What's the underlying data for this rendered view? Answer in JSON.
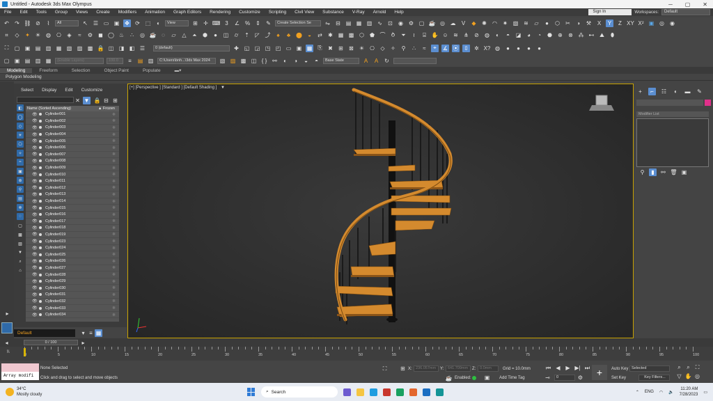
{
  "window": {
    "title": "Untitled - Autodesk 3ds Max Olympus"
  },
  "menu": {
    "items": [
      "File",
      "Edit",
      "Tools",
      "Group",
      "Views",
      "Create",
      "Modifiers",
      "Animation",
      "Graph Editors",
      "Rendering",
      "Customize",
      "Scripting",
      "Civil View",
      "Substance",
      "V-Ray",
      "Arnold",
      "Help"
    ],
    "sign_in": "Sign In",
    "workspaces_label": "Workspaces:",
    "workspaces_value": "Default"
  },
  "toolbar": {
    "filter_value": "All",
    "view_value": "View",
    "selection_set_placeholder": "Create Selection Se",
    "layer_value": "0 (default)",
    "enable_layers": "(Enable Layers)",
    "layer_num": "100.0",
    "path_value": "C:\\Users\\bnh...\\3ds Max 2024",
    "base_state": "Base State"
  },
  "ribbon": {
    "tabs": [
      "Modeling",
      "Freeform",
      "Selection",
      "Object Paint",
      "Populate"
    ],
    "active": "Modeling",
    "subtitle": "Polygon Modeling"
  },
  "scene_explorer": {
    "menu": [
      "Select",
      "Display",
      "Edit",
      "Customize"
    ],
    "col_name": "Name (Sorted Ascending)",
    "col_frozen": "▲ Frozen",
    "rows": [
      "Cylinder001",
      "Cylinder002",
      "Cylinder003",
      "Cylinder004",
      "Cylinder005",
      "Cylinder006",
      "Cylinder007",
      "Cylinder008",
      "Cylinder009",
      "Cylinder010",
      "Cylinder011",
      "Cylinder012",
      "Cylinder013",
      "Cylinder014",
      "Cylinder015",
      "Cylinder016",
      "Cylinder017",
      "Cylinder018",
      "Cylinder019",
      "Cylinder023",
      "Cylinder024",
      "Cylinder025",
      "Cylinder026",
      "Cylinder027",
      "Cylinder028",
      "Cylinder029",
      "Cylinder030",
      "Cylinder031",
      "Cylinder032",
      "Cylinder033",
      "Cylinder034"
    ],
    "layer": "Default"
  },
  "viewport": {
    "label": "[+] [Perspective ] [Standard ] [Default Shading ]",
    "frame_color": "#c8a200",
    "accent_color": "#d48a2e"
  },
  "command_panel": {
    "modifier_list": "Modifier List"
  },
  "timeline": {
    "slider_label": "0 / 100",
    "ticks": [
      "0",
      "5",
      "10",
      "15",
      "20",
      "25",
      "30",
      "35",
      "40",
      "45",
      "50",
      "55",
      "60",
      "65",
      "70",
      "75",
      "80",
      "85",
      "90",
      "95",
      "100"
    ]
  },
  "status": {
    "selection": "None Selected",
    "prompt": "Click and drag to select and move objects",
    "script_listener": "Array modifi",
    "x_label": "X:",
    "x_val": "236.057mm",
    "y_label": "Y:",
    "y_val": "641.709mm",
    "z_label": "Z:",
    "z_val": "0.0mm",
    "grid": "Grid = 10.0mm",
    "enabled": "Enabled:",
    "add_time_tag": "Add Time Tag",
    "auto_key": "Auto Key",
    "set_key": "Set Key",
    "selected": "Selected",
    "key_filters": "Key Filters...",
    "frame": "0"
  },
  "taskbar": {
    "temp": "34°C",
    "weather": "Mostly cloudy",
    "search": "Search",
    "lang": "ENG",
    "time": "11:20 AM",
    "date": "7/28/2023"
  }
}
